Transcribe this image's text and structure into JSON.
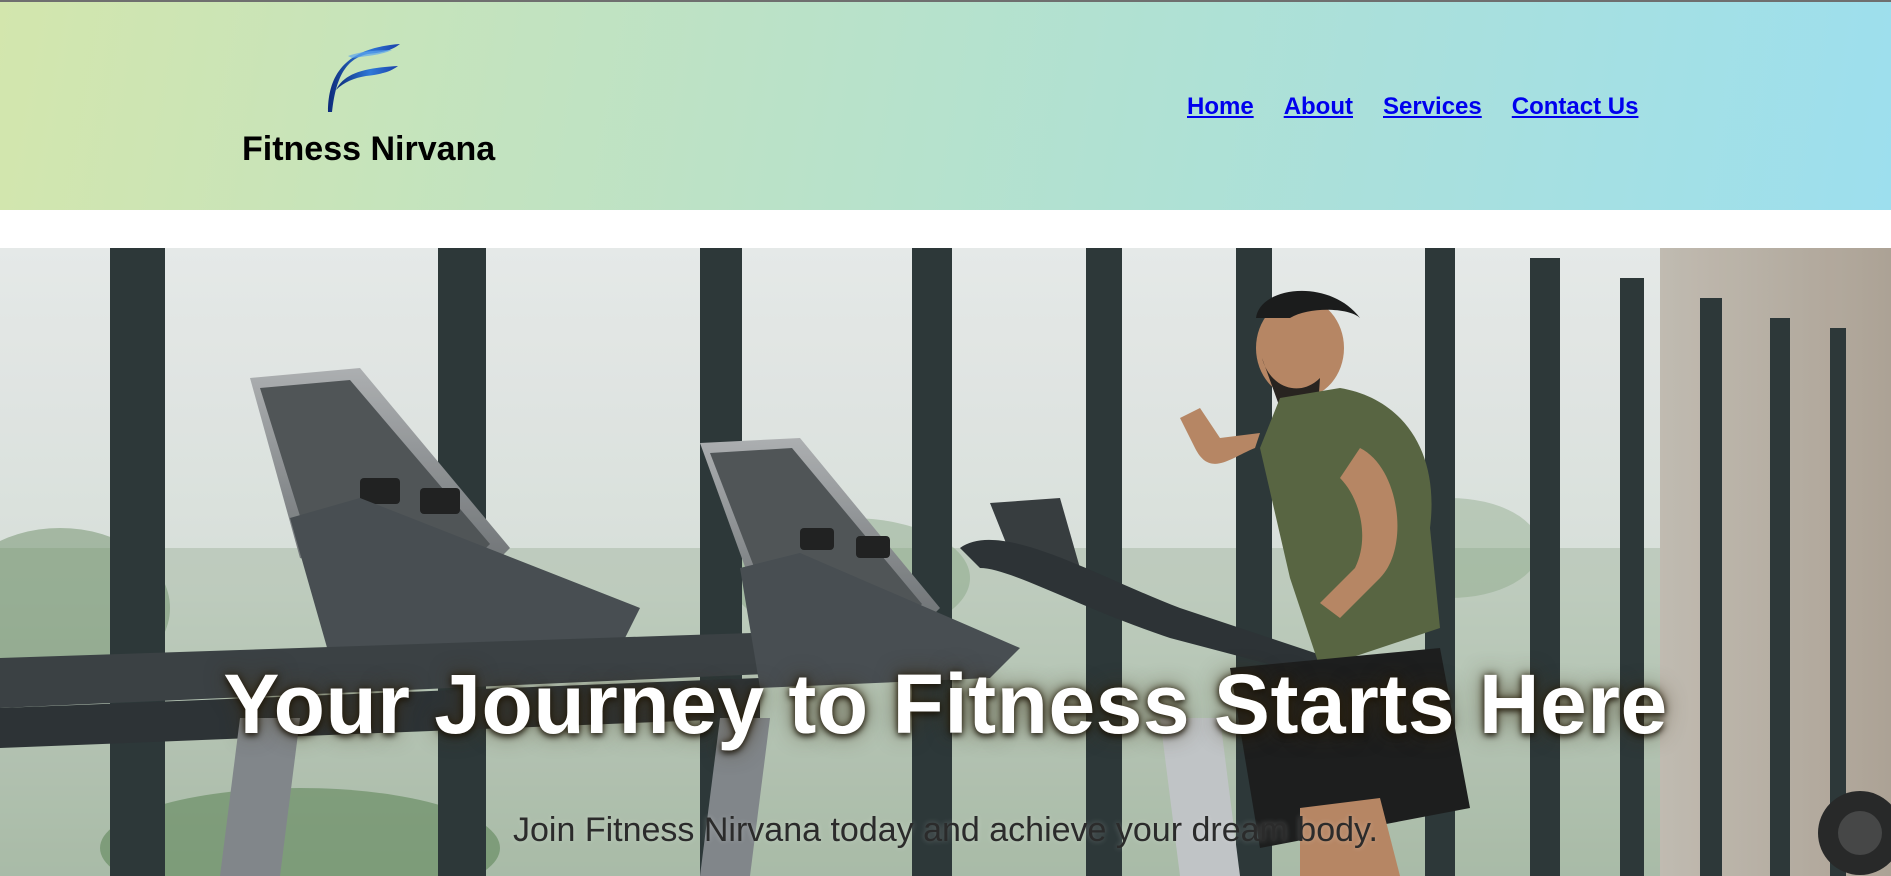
{
  "brand": {
    "name": "Fitness Nirvana",
    "logo_icon": "swoosh-logo-icon",
    "logo_colors": [
      "#1a3fa8",
      "#2f79d8",
      "#0d2a7a"
    ]
  },
  "nav": {
    "items": [
      {
        "label": "Home"
      },
      {
        "label": "About"
      },
      {
        "label": "Services"
      },
      {
        "label": "Contact Us"
      }
    ],
    "link_color": "#0000ee"
  },
  "header": {
    "gradient_colors": [
      "#d3e6ad",
      "#9ddfee"
    ]
  },
  "hero": {
    "title": "Your Journey to Fitness Starts Here",
    "subtitle": "Join Fitness Nirvana today and achieve your dream body.",
    "background_image": "gym-treadmill-runner-photo"
  }
}
